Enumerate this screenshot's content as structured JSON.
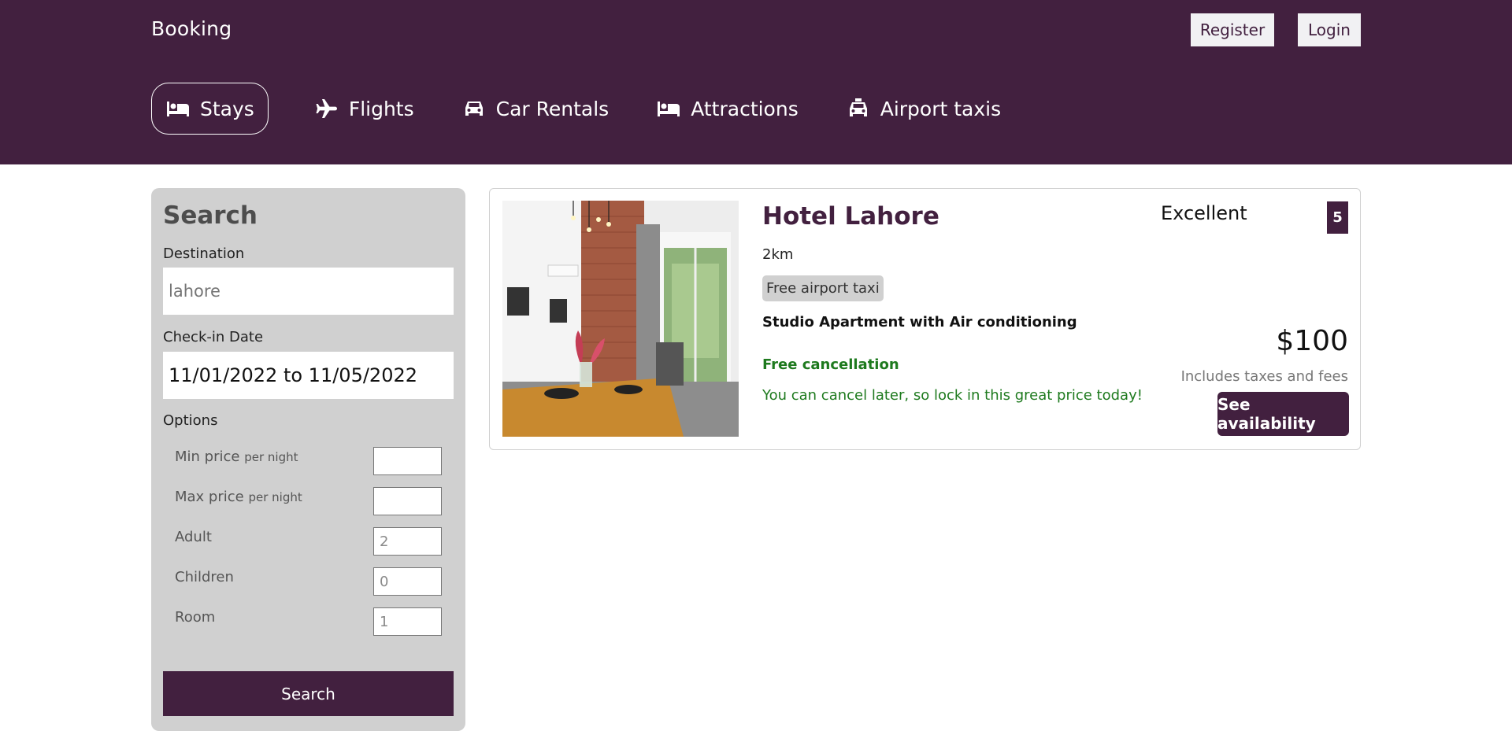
{
  "header": {
    "brand": "Booking",
    "register_label": "Register",
    "login_label": "Login"
  },
  "nav": {
    "items": [
      {
        "label": "Stays",
        "icon": "bed-icon",
        "active": true
      },
      {
        "label": "Flights",
        "icon": "plane-icon",
        "active": false
      },
      {
        "label": "Car Rentals",
        "icon": "car-icon",
        "active": false
      },
      {
        "label": "Attractions",
        "icon": "bed-icon",
        "active": false
      },
      {
        "label": "Airport taxis",
        "icon": "taxi-icon",
        "active": false
      }
    ]
  },
  "search": {
    "title": "Search",
    "destination_label": "Destination",
    "destination_value": "lahore",
    "checkin_label": "Check-in Date",
    "checkin_value": "11/01/2022 to 11/05/2022",
    "options_label": "Options",
    "options": [
      {
        "label": "Min price",
        "suffix": "per night",
        "value": ""
      },
      {
        "label": "Max price",
        "suffix": "per night",
        "value": ""
      },
      {
        "label": "Adult",
        "suffix": "",
        "value": "2"
      },
      {
        "label": "Children",
        "suffix": "",
        "value": "0"
      },
      {
        "label": "Room",
        "suffix": "",
        "value": "1"
      }
    ],
    "button_label": "Search"
  },
  "result": {
    "name": "Hotel Lahore",
    "distance": "2km",
    "taxi_badge": "Free airport taxi",
    "room_type": "Studio Apartment with Air conditioning",
    "cancel_title": "Free cancellation",
    "cancel_subtitle": "You can cancel later, so lock in this great price today!",
    "rating_text": "Excellent",
    "rating_score": "5",
    "price": "$100",
    "taxes_note": "Includes taxes and fees",
    "availability_label": "See availability"
  },
  "colors": {
    "brand": "#42203f",
    "panel": "#d0d0d0",
    "success": "#1e7a1e"
  }
}
